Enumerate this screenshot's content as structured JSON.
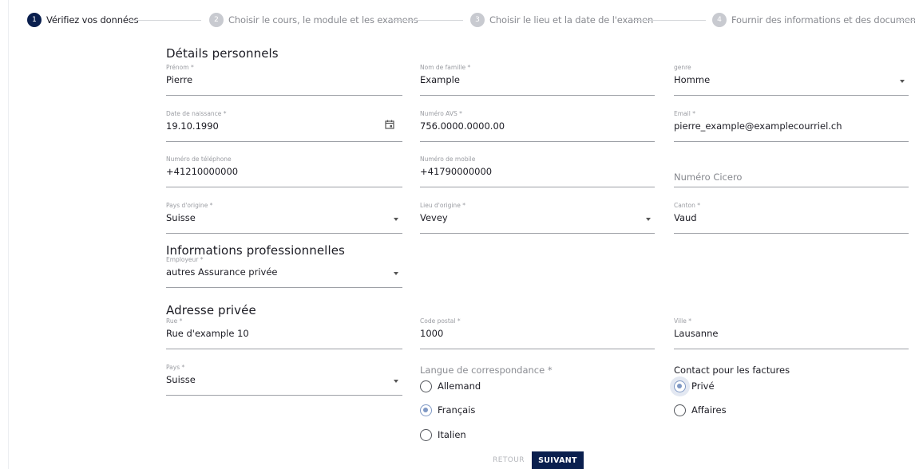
{
  "stepper": {
    "steps": [
      {
        "number": "1",
        "label": "Vérifiez vos données"
      },
      {
        "number": "2",
        "label": "Choisir le cours, le module et les examens"
      },
      {
        "number": "3",
        "label": "Choisir le lieu et la date de l'examen"
      },
      {
        "number": "4",
        "label": "Fournir des informations et des documents"
      }
    ]
  },
  "personal": {
    "title": "Détails personnels",
    "prenom": {
      "label": "Prénom *",
      "value": "Pierre"
    },
    "nom": {
      "label": "Nom de famille *",
      "value": "Example"
    },
    "genre": {
      "label": "genre",
      "value": "Homme"
    },
    "naissance": {
      "label": "Date de naissance *",
      "value": "19.10.1990"
    },
    "avs": {
      "label": "Numéro AVS *",
      "value": "756.0000.0000.00"
    },
    "email": {
      "label": "Email *",
      "value": "pierre_example@examplecourriel.ch"
    },
    "telephone": {
      "label": "Numéro de téléphone",
      "value": "+41210000000"
    },
    "mobile": {
      "label": "Numéro de mobile",
      "value": "+41790000000"
    },
    "cicero": {
      "placeholder": "Numéro Cicero"
    },
    "pays_origine": {
      "label": "Pays d'origine *",
      "value": "Suisse"
    },
    "lieu_origine": {
      "label": "Lieu d'origine *",
      "value": "Vevey"
    },
    "canton": {
      "label": "Canton *",
      "value": "Vaud"
    }
  },
  "professional": {
    "title": "Informations professionnelles",
    "employeur": {
      "label": "Employeur *",
      "value": "autres Assurance privée"
    }
  },
  "address": {
    "title": "Adresse privée",
    "rue": {
      "label": "Rue *",
      "value": "Rue d'example 10"
    },
    "code_postal": {
      "label": "Code postal *",
      "value": "1000"
    },
    "ville": {
      "label": "Ville *",
      "value": "Lausanne"
    },
    "pays": {
      "label": "Pays *",
      "value": "Suisse"
    }
  },
  "langue": {
    "title": "Langue de correspondance *",
    "options": [
      "Allemand",
      "Français",
      "Italien"
    ],
    "selected": "Français"
  },
  "facturation": {
    "title": "Contact pour les factures",
    "options": [
      "Privé",
      "Affaires"
    ],
    "selected": "Privé"
  },
  "buttons": {
    "back": "RETOUR",
    "next": "SUIVANT"
  },
  "colors": {
    "primary": "#0a1f4e",
    "radio_accent": "#7f98c4"
  }
}
